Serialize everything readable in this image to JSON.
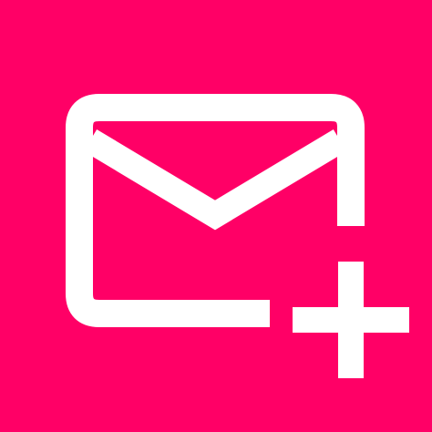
{
  "icon": {
    "name": "add-mail-icon",
    "parts": [
      "envelope-icon",
      "plus-icon"
    ]
  },
  "colors": {
    "background": "#FF0066",
    "foreground": "#FFFFFF"
  }
}
